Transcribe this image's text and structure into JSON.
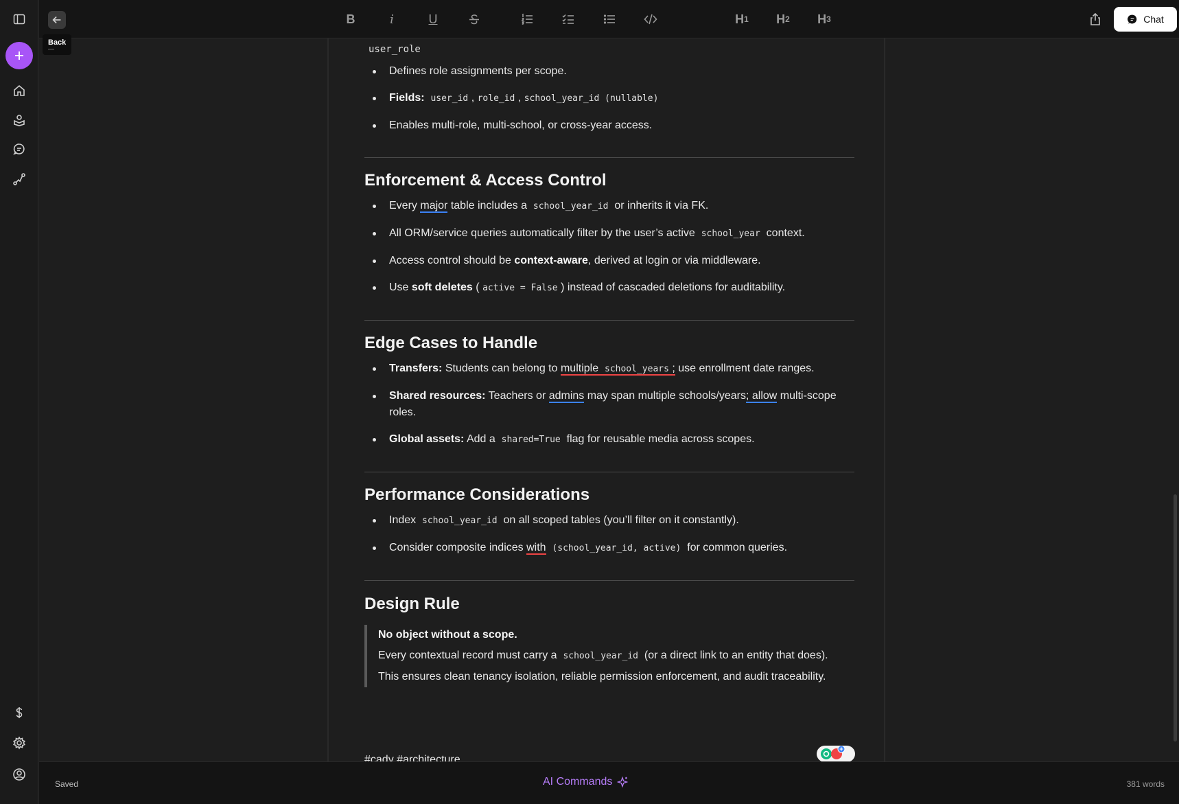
{
  "toolbar": {
    "back_tooltip": "Back",
    "back_shortcut": "—",
    "heading1": "H",
    "heading2": "H",
    "heading3": "H",
    "h1_sub": "1",
    "h2_sub": "2",
    "h3_sub": "3",
    "bold_label": "B",
    "italic_label": "i",
    "underline_label": "U",
    "chat_label": "Chat"
  },
  "doc": {
    "user_role_title": "user_role",
    "user_role_items": {
      "desc": "Defines role assignments per scope.",
      "fields_label": "Fields:",
      "field1": "user_id",
      "field2": "role_id",
      "field3": "school_year_id (nullable)",
      "access": "Enables multi-role, multi-school, or cross-year access."
    },
    "enforcement": {
      "heading": "Enforcement & Access Control",
      "i1_pre": "Every",
      "i1_major": "major",
      "i1_mid": "table includes a",
      "i1_code": "school_year_id",
      "i1_post": "or inherits it via FK.",
      "i2_pre": "All ORM/service queries automatically filter by the user’s active",
      "i2_code": "school_year",
      "i2_post": "context.",
      "i3_pre": "Access control should be",
      "i3_bold": "context-aware",
      "i3_post": ", derived at login or via middleware.",
      "i4_pre": "Use",
      "i4_bold": "soft deletes",
      "i4_open": "(",
      "i4_code": "active = False",
      "i4_post": ") instead of cascaded deletions for auditability."
    },
    "edge_cases": {
      "heading": "Edge Cases to Handle",
      "t_bold": "Transfers:",
      "t_pre": "Students can belong to",
      "t_multiple": "multiple",
      "t_code": "school_years",
      "t_semi": ";",
      "t_post": "use enrollment date ranges.",
      "s_bold": "Shared resources:",
      "s_pre": "Teachers or",
      "s_admins": "admins",
      "s_mid": "may span multiple schools/years",
      "s_allow": "; allow",
      "s_post": "multi-scope roles.",
      "g_bold": "Global assets:",
      "g_pre": "Add a",
      "g_code": "shared=True",
      "g_post": "flag for reusable media across scopes."
    },
    "performance": {
      "heading": "Performance Considerations",
      "p1_pre": "Index",
      "p1_code": "school_year_id",
      "p1_post": "on all scoped tables (you’ll filter on it constantly).",
      "p2_pre": "Consider composite indices",
      "p2_with": "with",
      "p2_code": "(school_year_id, active)",
      "p2_post": "for common queries."
    },
    "design_rule": {
      "heading": "Design Rule",
      "q_bold": "No object without a scope.",
      "q2_pre": "Every contextual record must carry a",
      "q2_code": "school_year_id",
      "q2_post": "(or a direct link to an entity that does).",
      "q3": "This ensures clean tenancy isolation, reliable permission enforcement, and audit traceability."
    },
    "tags": "#cady #architecture"
  },
  "footer": {
    "status": "Saved",
    "ai_commands": "AI Commands",
    "word_count": "381 words"
  },
  "colors": {
    "accent": "#a855f7",
    "ai_text": "#b57cf7",
    "spell_red": "#ef4444",
    "grammar_blue": "#3b82f6"
  }
}
